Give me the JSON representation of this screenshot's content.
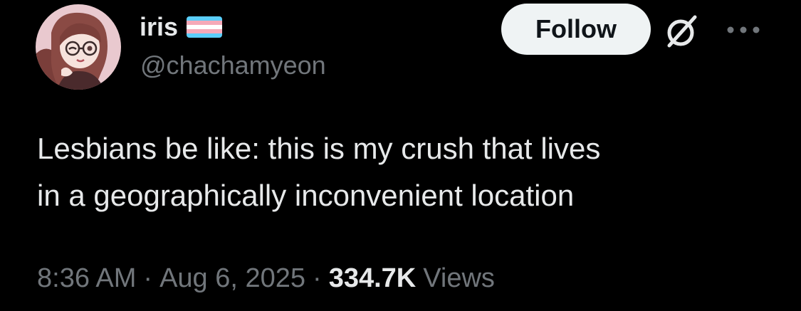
{
  "author": {
    "display_name": "iris",
    "handle": "@chachamyeon",
    "avatar_icon": "anime-avatar-icon",
    "name_badge_icon": "transgender-flag-icon"
  },
  "actions": {
    "follow_label": "Follow",
    "grok_icon": "grok-icon",
    "more_icon": "more-options-icon"
  },
  "tweet": {
    "text": "Lesbians be like: this is my crush that lives\nin a geographically inconvenient location"
  },
  "meta": {
    "time": "8:36 AM",
    "separator": "·",
    "date": "Aug 6, 2025",
    "views_count": "334.7K",
    "views_label": "Views"
  },
  "colors": {
    "background": "#000000",
    "primary_text": "#e7e9ea",
    "secondary_text": "#71767b",
    "follow_button_bg": "#eff3f4",
    "follow_button_text": "#0f1419",
    "flag_blue": "#5bcefa",
    "flag_pink": "#f5a9b8",
    "flag_white": "#ffffff"
  }
}
